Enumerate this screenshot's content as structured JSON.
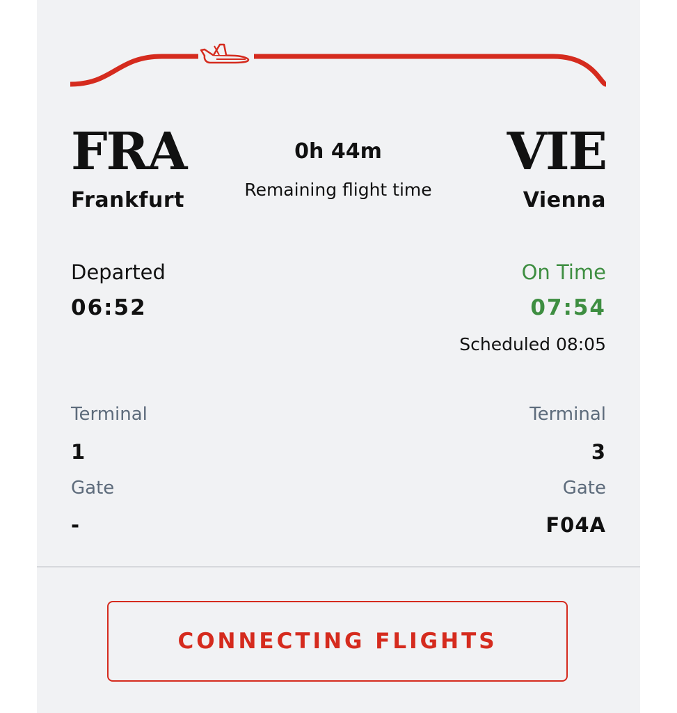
{
  "route": {
    "line_color": "#d52b1e",
    "plane_icon": "airplane-icon"
  },
  "origin": {
    "code": "FRA",
    "city": "Frankfurt",
    "status": "Departed",
    "time": "06:52",
    "terminal_label": "Terminal",
    "terminal": "1",
    "gate_label": "Gate",
    "gate": "-"
  },
  "destination": {
    "code": "VIE",
    "city": "Vienna",
    "status": "On Time",
    "time": "07:54",
    "scheduled": "Scheduled 08:05",
    "terminal_label": "Terminal",
    "terminal": "3",
    "gate_label": "Gate",
    "gate": "F04A"
  },
  "flight": {
    "remaining": "0h 44m",
    "remaining_label": "Remaining flight time"
  },
  "actions": {
    "connecting_flights": "CONNECTING FLIGHTS"
  },
  "colors": {
    "accent": "#d52b1e",
    "on_time": "#3e8e41",
    "label_gray": "#5d6b7b",
    "card_bg": "#f1f2f4"
  }
}
